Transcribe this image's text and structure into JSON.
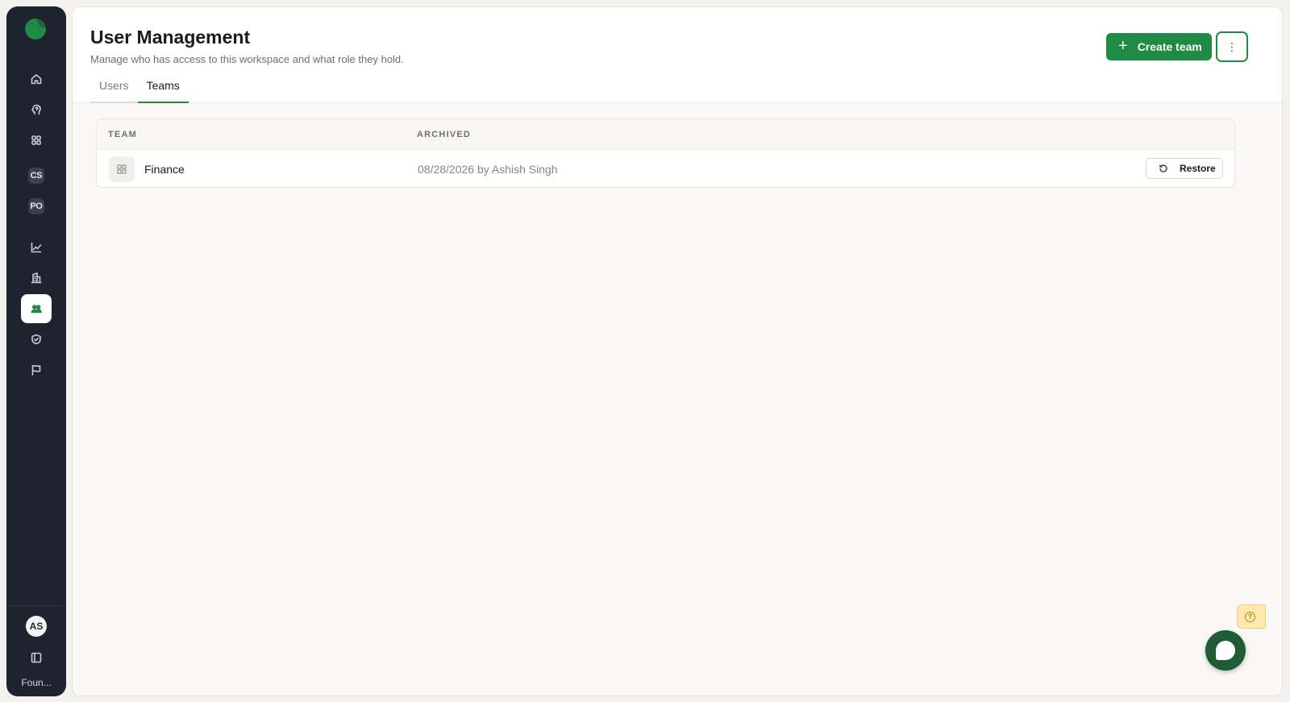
{
  "sidebar": {
    "workspace_label": "Foun...",
    "user_initials": "AS",
    "nav": [
      {
        "name": "home",
        "icon": "home-icon"
      },
      {
        "name": "insights",
        "icon": "brain-icon"
      },
      {
        "name": "apps",
        "icon": "grid-icon"
      },
      {
        "name": "cs",
        "badge": "CS"
      },
      {
        "name": "po",
        "badge": "PO"
      },
      {
        "name": "analytics",
        "icon": "chart-line-icon"
      },
      {
        "name": "organizations",
        "icon": "building-icon"
      },
      {
        "name": "user-management",
        "icon": "users-icon",
        "active": true
      },
      {
        "name": "security",
        "icon": "shield-icon"
      },
      {
        "name": "reports",
        "icon": "flag-icon"
      }
    ]
  },
  "header": {
    "title": "User Management",
    "subtitle": "Manage who has access to this workspace and what role they hold.",
    "create_label": "Create team",
    "more_glyph": "⋮"
  },
  "tabs": [
    {
      "label": "Users",
      "active": false
    },
    {
      "label": "Teams",
      "active": true
    }
  ],
  "table": {
    "columns": [
      "TEAM",
      "ARCHIVED"
    ],
    "rows": [
      {
        "team": "Finance",
        "archived": "08/28/2026 by Ashish Singh",
        "action": "Restore"
      }
    ]
  },
  "colors": {
    "accent": "#1f8a43",
    "sidebar_bg": "#1e2330",
    "help_tab": "#fde8b0"
  }
}
